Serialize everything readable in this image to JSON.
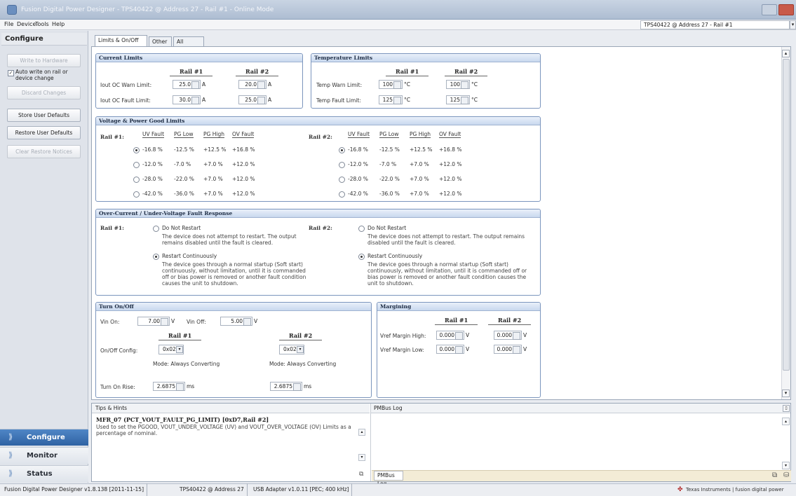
{
  "window": {
    "title": "Fusion Digital Power Designer - TPS40422 @ Address 27 - Rail #1 - Online Mode"
  },
  "menu": {
    "items": [
      "File",
      "Device",
      "Tools",
      "Help"
    ]
  },
  "device_selector": {
    "value": "TPS40422 @ Address 27 - Rail #1"
  },
  "sidebar": {
    "title": "Configure",
    "write_to_hardware": "Write to Hardware",
    "auto_write_label": "Auto write on rail or device change",
    "auto_write_checked": "✓",
    "discard_changes": "Discard Changes",
    "store_user_defaults": "Store User Defaults",
    "restore_user_defaults": "Restore User Defaults",
    "clear_restore_notices": "Clear Restore Notices",
    "nav": [
      {
        "label": "Configure",
        "selected": true
      },
      {
        "label": "Monitor",
        "selected": false
      },
      {
        "label": "Status",
        "selected": false
      }
    ]
  },
  "tabs": [
    {
      "label": "Limits & On/Off",
      "selected": true
    },
    {
      "label": "Other",
      "selected": false
    },
    {
      "label": "All Config",
      "selected": false
    }
  ],
  "current_limits": {
    "title": "Current Limits",
    "rail1_header": "Rail #1",
    "rail2_header": "Rail #2",
    "warn_label": "Iout OC Warn Limit:",
    "fault_label": "Iout OC Fault Limit:",
    "warn_rail1": "25.0",
    "warn_rail2": "20.0",
    "fault_rail1": "30.0",
    "fault_rail2": "25.0",
    "unit": "A"
  },
  "temperature_limits": {
    "title": "Temperature Limits",
    "rail1_header": "Rail #1",
    "rail2_header": "Rail #2",
    "warn_label": "Temp Warn Limit:",
    "fault_label": "Temp Fault Limit:",
    "warn_rail1": "100",
    "warn_rail2": "100",
    "fault_rail1": "125",
    "fault_rail2": "125",
    "unit": "°C"
  },
  "vpg_limits": {
    "title": "Voltage & Power Good Limits",
    "rail1_label": "Rail #1:",
    "rail2_label": "Rail #2:",
    "columns": [
      "UV Fault",
      "PG Low",
      "PG High",
      "OV Fault"
    ],
    "rows": [
      [
        "-16.8 %",
        "-12.5 %",
        "+12.5 %",
        "+16.8 %"
      ],
      [
        "-12.0 %",
        "-7.0 %",
        "+7.0 %",
        "+12.0 %"
      ],
      [
        "-28.0 %",
        "-22.0 %",
        "+7.0 %",
        "+12.0 %"
      ],
      [
        "-42.0 %",
        "-36.0 %",
        "+7.0 %",
        "+12.0 %"
      ]
    ],
    "selected_row": 0
  },
  "fault_response": {
    "title": "Over-Current / Under-Voltage Fault Response",
    "rail1_label": "Rail #1:",
    "rail2_label": "Rail #2:",
    "opt1_label": "Do Not Restart",
    "opt1_desc_r1": "The device does not attempt to restart. The output remains disabled until the fault is cleared.",
    "opt1_desc_r2": "The device does not attempt to restart. The output remains disabled until the fault is cleared.",
    "opt2_label": "Restart Continuously",
    "opt2_desc_r1": "The device goes through a normal startup (Soft start) continuously, without limitation, until it is commanded off or bias power is removed or another fault condition causes the unit to shutdown.",
    "opt2_desc_r2": "The device goes through a normal startup (Soft start) continuously, without limitation, until it is commanded off or bias power is removed or another fault condition causes the unit to shutdown."
  },
  "turn_on_off": {
    "title": "Turn On/Off",
    "vin_on_label": "Vin On:",
    "vin_on": "7.00",
    "vin_off_label": "Vin Off:",
    "vin_off": "5.00",
    "volt_unit": "V",
    "rail1_header": "Rail #1",
    "rail2_header": "Rail #2",
    "onoff_config_label": "On/Off Config:",
    "onoff_rail1": "0x02",
    "onoff_rail2": "0x02",
    "mode_rail1": "Mode: Always Converting",
    "mode_rail2": "Mode: Always Converting",
    "rise_label": "Turn On Rise:",
    "rise_rail1": "2.6875",
    "rise_rail2": "2.6875",
    "ms_unit": "ms"
  },
  "margining": {
    "title": "Margining",
    "rail1_header": "Rail #1",
    "rail2_header": "Rail #2",
    "high_label": "Vref Margin High:",
    "low_label": "Vref Margin Low:",
    "high_rail1": "0.000",
    "high_rail2": "0.000",
    "low_rail1": "0.000",
    "low_rail2": "0.000",
    "unit": "V"
  },
  "tips": {
    "header": "Tips & Hints",
    "title": "MFR_07 (PCT_VOUT_FAULT_PG_LIMIT) [0xD7,Rail #2]",
    "body": "Used to set the PGOOD, VOUT_UNDER_VOLTAGE (UV) and VOUT_OVER_VOLTAGE (OV) Limits as a percentage of nominal."
  },
  "pmbus": {
    "header": "PMBus Log",
    "tab": "PMBus Log"
  },
  "statusbar": {
    "version": "Fusion Digital Power Designer v1.8.138 [2011-11-15]",
    "device": "TPS40422 @ Address 27",
    "adapter": "USB Adapter v1.0.11 [PEC; 400 kHz]",
    "brand": "Texas Instruments | fusion digital power"
  },
  "colors": {
    "accent": "#2f62a3",
    "panel_border": "#7b95bd"
  }
}
